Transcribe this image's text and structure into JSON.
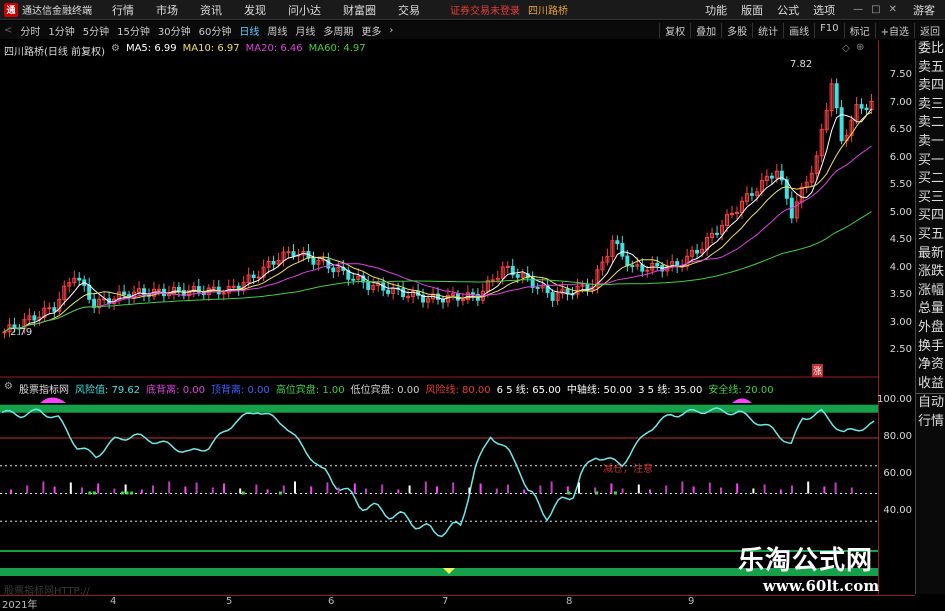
{
  "app": {
    "name": "通达信金融终端",
    "menu": [
      "行情",
      "市场",
      "资讯",
      "发现",
      "问小达",
      "财富圈",
      "交易"
    ],
    "warning": "证券交易未登录",
    "stock_tag": "四川路桥",
    "right_menu": [
      "功能",
      "版面",
      "公式",
      "选项"
    ],
    "guest": "游客"
  },
  "toolbar": {
    "periods": [
      "分时",
      "1分钟",
      "5分钟",
      "15分钟",
      "30分钟",
      "60分钟",
      "日线",
      "周线",
      "月线",
      "多周期",
      "更多"
    ],
    "right": [
      "复权",
      "叠加",
      "多股",
      "统计",
      "画线",
      "F10",
      "标记",
      "+自选",
      "返回"
    ]
  },
  "main_legend": {
    "title": "四川路桥(日线 前复权)",
    "ma5": "MA5: 6.99",
    "ma10": "MA10: 6.97",
    "ma20": "MA20: 6.46",
    "ma60": "MA60: 4.97",
    "colors": {
      "ma5": "#ffffff",
      "ma10": "#f0e060",
      "ma20": "#e040e0",
      "ma60": "#40d040"
    }
  },
  "price_annotations": {
    "high": "7.82",
    "low": "2.79",
    "marker": "涨"
  },
  "price_axis": [
    "7.50",
    "7.00",
    "6.50",
    "6.00",
    "5.50",
    "5.00",
    "4.50",
    "4.00",
    "3.50",
    "3.00",
    "2.50"
  ],
  "indicator_legend": {
    "name": "股票指标网",
    "items": [
      {
        "label": "风险值: 79.62",
        "color": "#40e0e0"
      },
      {
        "label": "底背离: 0.00",
        "color": "#e040e0"
      },
      {
        "label": "顶背离: 0.00",
        "color": "#4060ff"
      },
      {
        "label": "高位宾盘: 1.00",
        "color": "#40d040"
      },
      {
        "label": "低位宾盘: 0.00",
        "color": "#d0d0d0"
      },
      {
        "label": "风险线: 80.00",
        "color": "#e83c3c"
      },
      {
        "label": "6 5 线: 65.00",
        "color": "#ffffff"
      },
      {
        "label": "中轴线: 50.00",
        "color": "#ffffff"
      },
      {
        "label": "3 5 线: 35.00",
        "color": "#ffffff"
      },
      {
        "label": "安全线: 20.00",
        "color": "#40d040"
      }
    ],
    "annotation": "减仓，注意"
  },
  "indicator_axis": [
    "100.00",
    "80.00",
    "60.00",
    "40.00"
  ],
  "x_axis": [
    "2021年",
    "4",
    "5",
    "6",
    "7",
    "8",
    "9"
  ],
  "sidebar": [
    "委比",
    "卖五",
    "卖四",
    "卖三",
    "卖二",
    "卖一",
    "买一",
    "买二",
    "买三",
    "买四",
    "买五",
    "最新",
    "涨跌",
    "涨幅",
    "总量",
    "外盘",
    "换手",
    "净资",
    "收益",
    "自动",
    "行情"
  ],
  "watermark": {
    "cn": "乐淘公式网",
    "en": "www.60lt.com",
    "faint": "股票指标网HTTP://"
  }
}
